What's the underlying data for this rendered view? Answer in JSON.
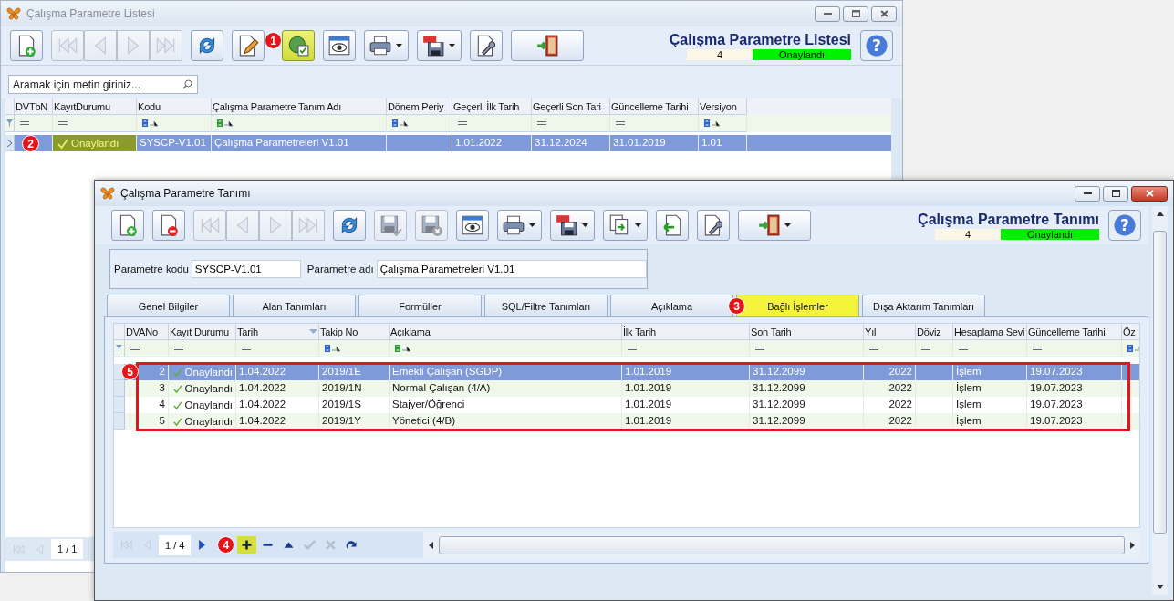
{
  "back_window": {
    "title": "Çalışma Parametre Listesi",
    "toolbar": [
      {
        "kind": "new",
        "disabled": false,
        "highlighted": false,
        "dropdown": false
      },
      {
        "kind": "first",
        "disabled": true,
        "highlighted": false,
        "dropdown": false
      },
      {
        "kind": "prev",
        "disabled": true,
        "highlighted": false,
        "dropdown": false
      },
      {
        "kind": "next",
        "disabled": true,
        "highlighted": false,
        "dropdown": false
      },
      {
        "kind": "last",
        "disabled": true,
        "highlighted": false,
        "dropdown": false
      },
      {
        "kind": "refresh",
        "disabled": false,
        "highlighted": false,
        "dropdown": false
      },
      {
        "kind": "edit",
        "disabled": false,
        "highlighted": false,
        "dropdown": false,
        "callout": "1"
      },
      {
        "kind": "approve",
        "disabled": false,
        "highlighted": true,
        "dropdown": false
      },
      {
        "kind": "preview",
        "disabled": false,
        "highlighted": false,
        "dropdown": false
      },
      {
        "kind": "print",
        "disabled": false,
        "highlighted": false,
        "dropdown": true
      },
      {
        "kind": "pdf",
        "disabled": false,
        "highlighted": false,
        "dropdown": true
      },
      {
        "kind": "settings",
        "disabled": false,
        "highlighted": false,
        "dropdown": false
      },
      {
        "kind": "exit",
        "disabled": false,
        "highlighted": false,
        "dropdown": false
      }
    ],
    "heading": "Çalışma Parametre Listesi",
    "record_count": "4",
    "status": "Onaylandı",
    "help_button": "?",
    "search": {
      "placeholder": "Aramak için metin giriniz..."
    },
    "grid": {
      "columns": [
        {
          "label": "DVTbN",
          "filter": {
            "kind": "equals"
          },
          "kind": "text"
        },
        {
          "label": "KayıtDurumu",
          "filter": {
            "kind": "equals"
          },
          "kind": "status"
        },
        {
          "label": "Kodu",
          "filter": {
            "kind": "abc"
          },
          "kind": "text"
        },
        {
          "label": "Çalışma Parametre Tanım Adı",
          "filter": {
            "kind": "abcgreen"
          },
          "kind": "text"
        },
        {
          "label": "Dönem Periy",
          "filter": {
            "kind": "abc"
          },
          "kind": "text"
        },
        {
          "label": "Geçerli İlk Tarih",
          "filter": {
            "kind": "equals"
          },
          "kind": "text"
        },
        {
          "label": "Geçerli Son Tari",
          "filter": {
            "kind": "equals"
          },
          "kind": "text"
        },
        {
          "label": "Güncelleme Tarihi",
          "filter": {
            "kind": "equals"
          },
          "kind": "text"
        },
        {
          "label": "Versiyon",
          "filter": {
            "kind": "abc"
          },
          "kind": "text"
        }
      ],
      "rows": [
        {
          "selected": true,
          "status_focused": true,
          "callout": "2",
          "cells": [
            "",
            "Onaylandı",
            "SYSCP-V1.01",
            "Çalışma Parametreleri V1.01",
            "",
            "1.01.2022",
            "31.12.2024",
            "31.01.2019",
            "1.01"
          ]
        }
      ]
    },
    "pager": {
      "text": "1 / 1",
      "buttons": [
        {
          "kind": "first",
          "disabled": true,
          "highlighted": false
        },
        {
          "kind": "prev",
          "disabled": true,
          "highlighted": false
        }
      ]
    }
  },
  "front_window": {
    "title": "Çalışma Parametre Tanımı",
    "toolbar": [
      {
        "kind": "new",
        "disabled": false,
        "highlighted": false,
        "dropdown": false
      },
      {
        "kind": "delete",
        "disabled": false,
        "highlighted": false,
        "dropdown": false
      },
      {
        "kind": "first",
        "disabled": true,
        "highlighted": false,
        "dropdown": false
      },
      {
        "kind": "prev",
        "disabled": true,
        "highlighted": false,
        "dropdown": false
      },
      {
        "kind": "next",
        "disabled": true,
        "highlighted": false,
        "dropdown": false
      },
      {
        "kind": "last",
        "disabled": true,
        "highlighted": false,
        "dropdown": false
      },
      {
        "kind": "refresh",
        "disabled": false,
        "highlighted": false,
        "dropdown": false
      },
      {
        "kind": "save",
        "disabled": true,
        "highlighted": false,
        "dropdown": false
      },
      {
        "kind": "cancelsave",
        "disabled": true,
        "highlighted": false,
        "dropdown": false
      },
      {
        "kind": "preview",
        "disabled": false,
        "highlighted": false,
        "dropdown": false
      },
      {
        "kind": "print",
        "disabled": false,
        "highlighted": false,
        "dropdown": true
      },
      {
        "kind": "pdf",
        "disabled": false,
        "highlighted": false,
        "dropdown": true
      },
      {
        "kind": "export",
        "disabled": false,
        "highlighted": false,
        "dropdown": true
      },
      {
        "kind": "import",
        "disabled": false,
        "highlighted": false,
        "dropdown": false
      },
      {
        "kind": "settings",
        "disabled": false,
        "highlighted": false,
        "dropdown": false
      },
      {
        "kind": "exit",
        "disabled": false,
        "highlighted": false,
        "dropdown": true
      }
    ],
    "heading": "Çalışma Parametre Tanımı",
    "record_count": "4",
    "status": "Onaylandı",
    "help_button": "?",
    "fields": [
      {
        "label": "Parametre kodu",
        "value": "SYSCP-V1.01"
      },
      {
        "label": "Parametre adı",
        "value": "Çalışma Parametreleri V1.01"
      }
    ],
    "tabs": [
      {
        "label": "Genel Bilgiler",
        "selected": false
      },
      {
        "label": "Alan Tanımları",
        "selected": false
      },
      {
        "label": "Formüller",
        "selected": false
      },
      {
        "label": "SQL/Filtre Tanımları",
        "selected": false
      },
      {
        "label": "Açıklama",
        "selected": false
      },
      {
        "label": "Bağlı İşlemler",
        "selected": true,
        "callout": "3"
      },
      {
        "label": "Dışa Aktarım Tanımları",
        "selected": false
      }
    ],
    "grid": {
      "rows_highlighted": true,
      "callout": "5",
      "columns": [
        {
          "label": "DVANo",
          "filter": {
            "kind": "equals"
          },
          "kind": "number"
        },
        {
          "label": "Kayıt Durumu",
          "filter": {
            "kind": "equals"
          },
          "kind": "status"
        },
        {
          "label": "Tarih",
          "filter": {
            "kind": "equals"
          },
          "kind": "text",
          "sorted_descending": true
        },
        {
          "label": "Takip No",
          "filter": {
            "kind": "abc"
          },
          "kind": "text"
        },
        {
          "label": "Açıklama",
          "filter": {
            "kind": "abcgreen"
          },
          "kind": "text"
        },
        {
          "label": "İlk Tarih",
          "filter": {
            "kind": "equals"
          },
          "kind": "text"
        },
        {
          "label": "Son Tarih",
          "filter": {
            "kind": "equals"
          },
          "kind": "text"
        },
        {
          "label": "Yıl",
          "filter": {
            "kind": "equals"
          },
          "kind": "number"
        },
        {
          "label": "Döviz",
          "filter": {
            "kind": "equals"
          },
          "kind": "text"
        },
        {
          "label": "Hesaplama Sevi",
          "filter": {
            "kind": "equals"
          },
          "kind": "text"
        },
        {
          "label": "Güncelleme Tarihi",
          "filter": {
            "kind": "equals"
          },
          "kind": "text"
        },
        {
          "label": "Öz",
          "filter": {
            "kind": "abc"
          },
          "kind": "text"
        }
      ],
      "rows": [
        {
          "selected": true,
          "status_focused": false,
          "cells": [
            "2",
            "Onaylandı",
            "1.04.2022",
            "2019/1E",
            "Emekli Çalışan (SGDP)",
            "1.01.2019",
            "31.12.2099",
            "2022",
            "",
            "İşlem",
            "19.07.2023",
            ""
          ]
        },
        {
          "selected": false,
          "status_focused": false,
          "cells": [
            "3",
            "Onaylandı",
            "1.04.2022",
            "2019/1N",
            "Normal Çalışan (4/A)",
            "1.01.2019",
            "31.12.2099",
            "2022",
            "",
            "İşlem",
            "19.07.2023",
            ""
          ]
        },
        {
          "selected": false,
          "status_focused": false,
          "cells": [
            "4",
            "Onaylandı",
            "1.04.2022",
            "2019/1S",
            "Stajyer/Öğrenci",
            "1.01.2019",
            "31.12.2099",
            "2022",
            "",
            "İşlem",
            "19.07.2023",
            ""
          ]
        },
        {
          "selected": false,
          "status_focused": false,
          "cells": [
            "5",
            "Onaylandı",
            "1.04.2022",
            "2019/1Y",
            "Yönetici (4/B)",
            "1.01.2019",
            "31.12.2099",
            "2022",
            "",
            "İşlem",
            "19.07.2023",
            ""
          ]
        }
      ]
    },
    "pager": {
      "text": "1 / 4",
      "buttons": [
        {
          "kind": "first",
          "disabled": true,
          "highlighted": false
        },
        {
          "kind": "prev",
          "disabled": true,
          "highlighted": false
        },
        {
          "kind": "next",
          "disabled": false,
          "highlighted": false
        },
        {
          "kind": "add",
          "disabled": false,
          "highlighted": true,
          "callout": "4"
        },
        {
          "kind": "remove",
          "disabled": false,
          "highlighted": false
        },
        {
          "kind": "up",
          "disabled": false,
          "highlighted": false
        },
        {
          "kind": "check",
          "disabled": true,
          "highlighted": false
        },
        {
          "kind": "cancel",
          "disabled": true,
          "highlighted": false
        },
        {
          "kind": "redo",
          "disabled": false,
          "highlighted": false
        }
      ]
    }
  }
}
